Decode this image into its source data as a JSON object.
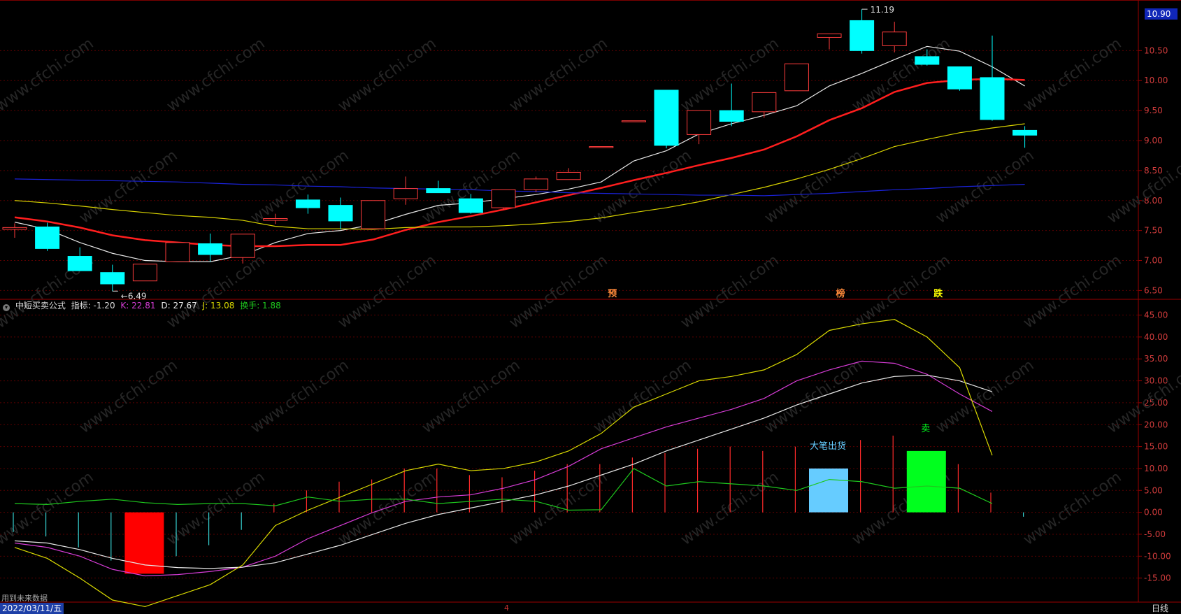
{
  "chart_data": [
    {
      "type": "candlestick",
      "panel": "main",
      "current_price_label": "10.90",
      "y_ticks": [
        "10.50",
        "10.00",
        "9.50",
        "9.00",
        "8.50",
        "8.00",
        "7.50",
        "7.00",
        "6.50"
      ],
      "ylim": [
        6.4,
        11.25
      ],
      "annotations": [
        {
          "text": "11.19",
          "index": 26
        },
        {
          "text": "6.49",
          "index": 3
        }
      ],
      "signals": [
        {
          "text": "预",
          "index": 18,
          "color": "#ff8a3a"
        },
        {
          "text": "榜",
          "index": 25,
          "color": "#ff8a3a"
        },
        {
          "text": "跌",
          "index": 28,
          "color": "#ffff00"
        }
      ],
      "candles": [
        {
          "o": 7.52,
          "h": 7.62,
          "l": 7.38,
          "c": 7.55
        },
        {
          "o": 7.56,
          "h": 7.63,
          "l": 7.16,
          "c": 7.2
        },
        {
          "o": 7.07,
          "h": 7.22,
          "l": 6.84,
          "c": 6.83
        },
        {
          "o": 6.8,
          "h": 6.93,
          "l": 6.49,
          "c": 6.61
        },
        {
          "o": 6.66,
          "h": 6.93,
          "l": 6.66,
          "c": 6.94
        },
        {
          "o": 6.98,
          "h": 7.3,
          "l": 6.98,
          "c": 7.3
        },
        {
          "o": 7.28,
          "h": 7.45,
          "l": 6.98,
          "c": 7.1
        },
        {
          "o": 7.05,
          "h": 7.44,
          "l": 6.95,
          "c": 7.44
        },
        {
          "o": 7.67,
          "h": 7.78,
          "l": 7.61,
          "c": 7.7
        },
        {
          "o": 8.01,
          "h": 8.1,
          "l": 7.78,
          "c": 7.88
        },
        {
          "o": 7.92,
          "h": 8.05,
          "l": 7.52,
          "c": 7.66
        },
        {
          "o": 7.53,
          "h": 8.0,
          "l": 7.52,
          "c": 8.0
        },
        {
          "o": 8.03,
          "h": 8.4,
          "l": 7.93,
          "c": 8.2
        },
        {
          "o": 8.2,
          "h": 8.33,
          "l": 8.13,
          "c": 8.13
        },
        {
          "o": 8.03,
          "h": 8.11,
          "l": 7.78,
          "c": 7.8
        },
        {
          "o": 7.88,
          "h": 8.18,
          "l": 7.85,
          "c": 8.18
        },
        {
          "o": 8.18,
          "h": 8.4,
          "l": 8.14,
          "c": 8.36
        },
        {
          "o": 8.35,
          "h": 8.54,
          "l": 8.35,
          "c": 8.47
        },
        {
          "o": 8.9,
          "h": 8.9,
          "l": 8.9,
          "c": 8.9
        },
        {
          "o": 9.33,
          "h": 9.33,
          "l": 9.33,
          "c": 9.33
        },
        {
          "o": 9.84,
          "h": 9.84,
          "l": 8.87,
          "c": 8.92
        },
        {
          "o": 9.1,
          "h": 9.5,
          "l": 8.94,
          "c": 9.5
        },
        {
          "o": 9.5,
          "h": 9.95,
          "l": 9.24,
          "c": 9.32
        },
        {
          "o": 9.48,
          "h": 9.8,
          "l": 9.38,
          "c": 9.8
        },
        {
          "o": 9.83,
          "h": 10.28,
          "l": 9.83,
          "c": 10.28
        },
        {
          "o": 10.72,
          "h": 10.78,
          "l": 10.52,
          "c": 10.78
        },
        {
          "o": 11.0,
          "h": 11.19,
          "l": 10.45,
          "c": 10.5
        },
        {
          "o": 10.58,
          "h": 10.98,
          "l": 10.47,
          "c": 10.81
        },
        {
          "o": 10.4,
          "h": 10.52,
          "l": 10.25,
          "c": 10.27
        },
        {
          "o": 10.23,
          "h": 10.23,
          "l": 9.83,
          "c": 9.86
        },
        {
          "o": 10.05,
          "h": 10.75,
          "l": 9.33,
          "c": 9.35
        },
        {
          "o": 9.17,
          "h": 9.24,
          "l": 8.88,
          "c": 9.09
        }
      ],
      "moving_averages": [
        {
          "color": "#e6e6e6",
          "values": [
            7.64,
            7.52,
            7.3,
            7.12,
            7.0,
            6.98,
            6.98,
            7.09,
            7.3,
            7.45,
            7.5,
            7.6,
            7.77,
            7.92,
            7.96,
            8.03,
            8.1,
            8.19,
            8.31,
            8.66,
            8.83,
            9.11,
            9.28,
            9.42,
            9.58,
            9.91,
            10.12,
            10.35,
            10.57,
            10.49,
            10.23,
            9.91
          ]
        },
        {
          "color": "#ff1e1e",
          "values": [
            7.72,
            7.65,
            7.55,
            7.42,
            7.34,
            7.3,
            7.26,
            7.24,
            7.24,
            7.26,
            7.26,
            7.35,
            7.51,
            7.64,
            7.74,
            7.85,
            7.97,
            8.09,
            8.21,
            8.34,
            8.46,
            8.59,
            8.71,
            8.85,
            9.07,
            9.34,
            9.54,
            9.81,
            9.96,
            10.01,
            10.03,
            10.01
          ]
        },
        {
          "color": "#d8d200",
          "values": [
            8.0,
            7.96,
            7.91,
            7.85,
            7.8,
            7.75,
            7.72,
            7.67,
            7.57,
            7.53,
            7.53,
            7.52,
            7.55,
            7.56,
            7.56,
            7.58,
            7.61,
            7.65,
            7.71,
            7.8,
            7.88,
            7.98,
            8.1,
            8.22,
            8.36,
            8.52,
            8.7,
            8.9,
            9.02,
            9.13,
            9.21,
            9.28
          ]
        },
        {
          "color": "#1a22d8",
          "values": [
            8.36,
            8.35,
            8.34,
            8.33,
            8.32,
            8.31,
            8.29,
            8.27,
            8.26,
            8.24,
            8.23,
            8.21,
            8.2,
            8.19,
            8.18,
            8.16,
            8.15,
            8.13,
            8.12,
            8.11,
            8.1,
            8.09,
            8.09,
            8.08,
            8.1,
            8.12,
            8.15,
            8.18,
            8.2,
            8.23,
            8.25,
            8.27
          ]
        }
      ]
    },
    {
      "type": "line",
      "panel": "indicator",
      "indicator_title": "中短买卖公式",
      "indicator_readout": "指标: -1.20",
      "k_label": "K: 22.81",
      "d_label": "D: 27.67",
      "j_label": "J: 13.08",
      "turnover_label": "换手: 1.88",
      "y_ticks": [
        "45.00",
        "40.00",
        "35.00",
        "30.00",
        "25.00",
        "20.00",
        "15.00",
        "10.00",
        "5.00",
        "0.00",
        "-5.00",
        "-10.00",
        "-15.00"
      ],
      "ylim": [
        -20,
        47
      ],
      "series": [
        {
          "name": "K",
          "color": "#d63cd6",
          "values": [
            -7,
            -8,
            -10,
            -13,
            -14.5,
            -14.2,
            -13.5,
            -12.5,
            -10,
            -6,
            -3,
            0,
            2.5,
            3.5,
            4,
            5.5,
            7.5,
            10.5,
            14.5,
            17,
            19.5,
            21.5,
            23.5,
            26,
            30,
            32.5,
            34.5,
            34,
            31.5,
            27,
            23
          ]
        },
        {
          "name": "D",
          "color": "#e8e8e8",
          "values": [
            -6.5,
            -7,
            -8.5,
            -10.5,
            -12,
            -12.6,
            -12.8,
            -12.5,
            -11.5,
            -9.5,
            -7.5,
            -5,
            -2.5,
            -0.5,
            1,
            2.5,
            4,
            6,
            8.5,
            11,
            14,
            16.5,
            19,
            21.5,
            24.5,
            27,
            29.5,
            31,
            31.3,
            30,
            27.5
          ]
        },
        {
          "name": "J",
          "color": "#dada00",
          "values": [
            -8,
            -10.5,
            -15,
            -20,
            -21.5,
            -19,
            -16.5,
            -12,
            -3,
            0.5,
            3.5,
            6.5,
            9.5,
            11,
            9.5,
            10,
            11.5,
            14,
            18,
            24,
            27,
            30,
            31,
            32.5,
            36,
            41.5,
            43,
            44,
            40,
            33,
            13
          ]
        },
        {
          "name": "换手",
          "color": "#1ec81e",
          "values": [
            2,
            1.8,
            2.5,
            3,
            2.2,
            1.8,
            2,
            2,
            1.5,
            3.5,
            2.5,
            3,
            3,
            2,
            2.5,
            3,
            2.5,
            0.5,
            0.6,
            10,
            6,
            7,
            6.5,
            6,
            5,
            7.5,
            7,
            5.5,
            6,
            5.5,
            2
          ]
        }
      ],
      "histogram": [
        {
          "v": -4.5,
          "color": "#36d0d0"
        },
        {
          "v": -5.5,
          "color": "#36d0d0"
        },
        {
          "v": -8,
          "color": "#36d0d0"
        },
        {
          "v": -11,
          "color": "#36d0d0"
        },
        {
          "v": -14,
          "color": "#ff0000",
          "wide": true
        },
        {
          "v": -10,
          "color": "#36d0d0"
        },
        {
          "v": -7.5,
          "color": "#36d0d0"
        },
        {
          "v": -4,
          "color": "#36d0d0"
        },
        {
          "v": 2,
          "color": "#ff2a2a"
        },
        {
          "v": 5,
          "color": "#ff2a2a"
        },
        {
          "v": 7,
          "color": "#ff2a2a"
        },
        {
          "v": 7.5,
          "color": "#ff2a2a"
        },
        {
          "v": 10,
          "color": "#ff2a2a"
        },
        {
          "v": 10,
          "color": "#ff2a2a"
        },
        {
          "v": 8.5,
          "color": "#ff2a2a"
        },
        {
          "v": 8,
          "color": "#ff2a2a"
        },
        {
          "v": 9.5,
          "color": "#ff2a2a"
        },
        {
          "v": 11,
          "color": "#ff2a2a"
        },
        {
          "v": 11,
          "color": "#ff2a2a"
        },
        {
          "v": 12.5,
          "color": "#ff2a2a"
        },
        {
          "v": 13.5,
          "color": "#ff2a2a"
        },
        {
          "v": 14.5,
          "color": "#ff2a2a"
        },
        {
          "v": 15,
          "color": "#ff2a2a"
        },
        {
          "v": 14,
          "color": "#ff2a2a"
        },
        {
          "v": 15,
          "color": "#ff2a2a"
        },
        {
          "v": 10,
          "color": "#66ccff",
          "wide": true,
          "label": "大笔出货"
        },
        {
          "v": 16.5,
          "color": "#ff2a2a"
        },
        {
          "v": 17.5,
          "color": "#ff2a2a"
        },
        {
          "v": 14,
          "color": "#00ff1e",
          "wide": true,
          "label": "卖"
        },
        {
          "v": 11,
          "color": "#ff2a2a"
        },
        {
          "v": 4.5,
          "color": "#ff2a2a"
        },
        {
          "v": -1,
          "color": "#36d0d0"
        }
      ]
    }
  ],
  "status_bar": {
    "date": "2022/03/11/五",
    "note": "用到未来数据",
    "period": "日线",
    "mid_marker": "4"
  },
  "watermark": "www.cfchi.com"
}
